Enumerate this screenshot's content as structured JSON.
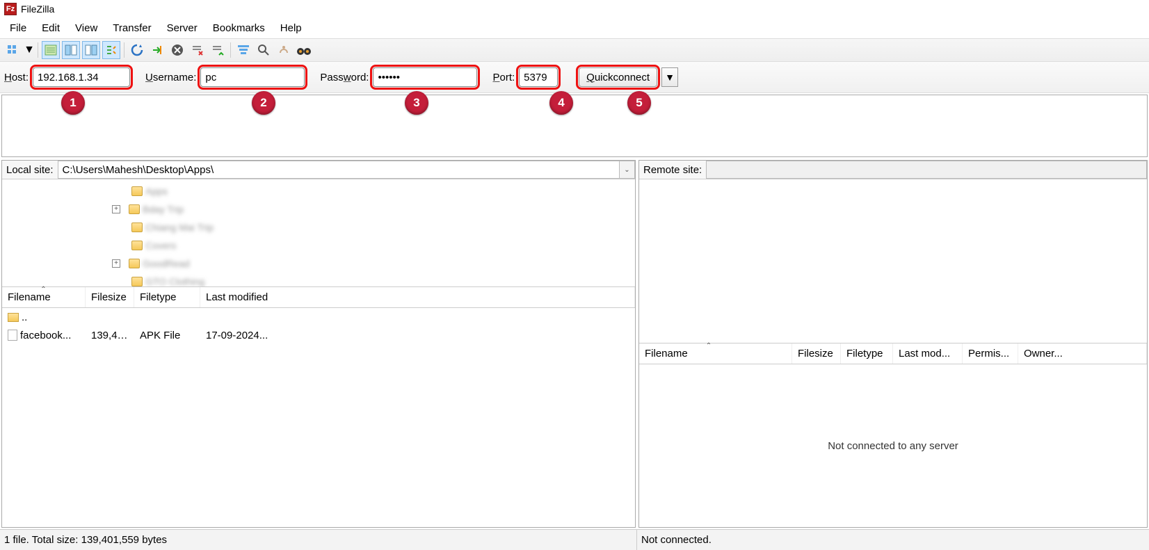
{
  "app": {
    "title": "FileZilla"
  },
  "menu": [
    "File",
    "Edit",
    "View",
    "Transfer",
    "Server",
    "Bookmarks",
    "Help"
  ],
  "quick": {
    "host_label": "Host:",
    "host_value": "192.168.1.34",
    "user_label": "Username:",
    "user_value": "pc",
    "pass_label": "Password:",
    "pass_value": "••••••",
    "port_label": "Port:",
    "port_value": "5379",
    "button": "Quickconnect"
  },
  "annotations": [
    "1",
    "2",
    "3",
    "4",
    "5"
  ],
  "local": {
    "site_label": "Local site:",
    "site_value": "C:\\Users\\Mahesh\\Desktop\\Apps\\",
    "tree_items": [
      {
        "expandable": false,
        "label": "Apps"
      },
      {
        "expandable": true,
        "label": "Bday Trip"
      },
      {
        "expandable": false,
        "label": "Chiang Mai Trip"
      },
      {
        "expandable": false,
        "label": "Covers"
      },
      {
        "expandable": true,
        "label": "GoodRead"
      },
      {
        "expandable": false,
        "label": "GTO Clothing"
      }
    ],
    "columns": [
      "Filename",
      "Filesize",
      "Filetype",
      "Last modified"
    ],
    "rows": [
      {
        "icon": "folder",
        "name": "..",
        "size": "",
        "type": "",
        "mod": ""
      },
      {
        "icon": "file",
        "name": "facebook...",
        "size": "139,40...",
        "type": "APK File",
        "mod": "17-09-2024..."
      }
    ],
    "status": "1 file. Total size: 139,401,559 bytes"
  },
  "remote": {
    "site_label": "Remote site:",
    "columns": [
      "Filename",
      "Filesize",
      "Filetype",
      "Last mod...",
      "Permis...",
      "Owner..."
    ],
    "message": "Not connected to any server",
    "status": "Not connected."
  }
}
